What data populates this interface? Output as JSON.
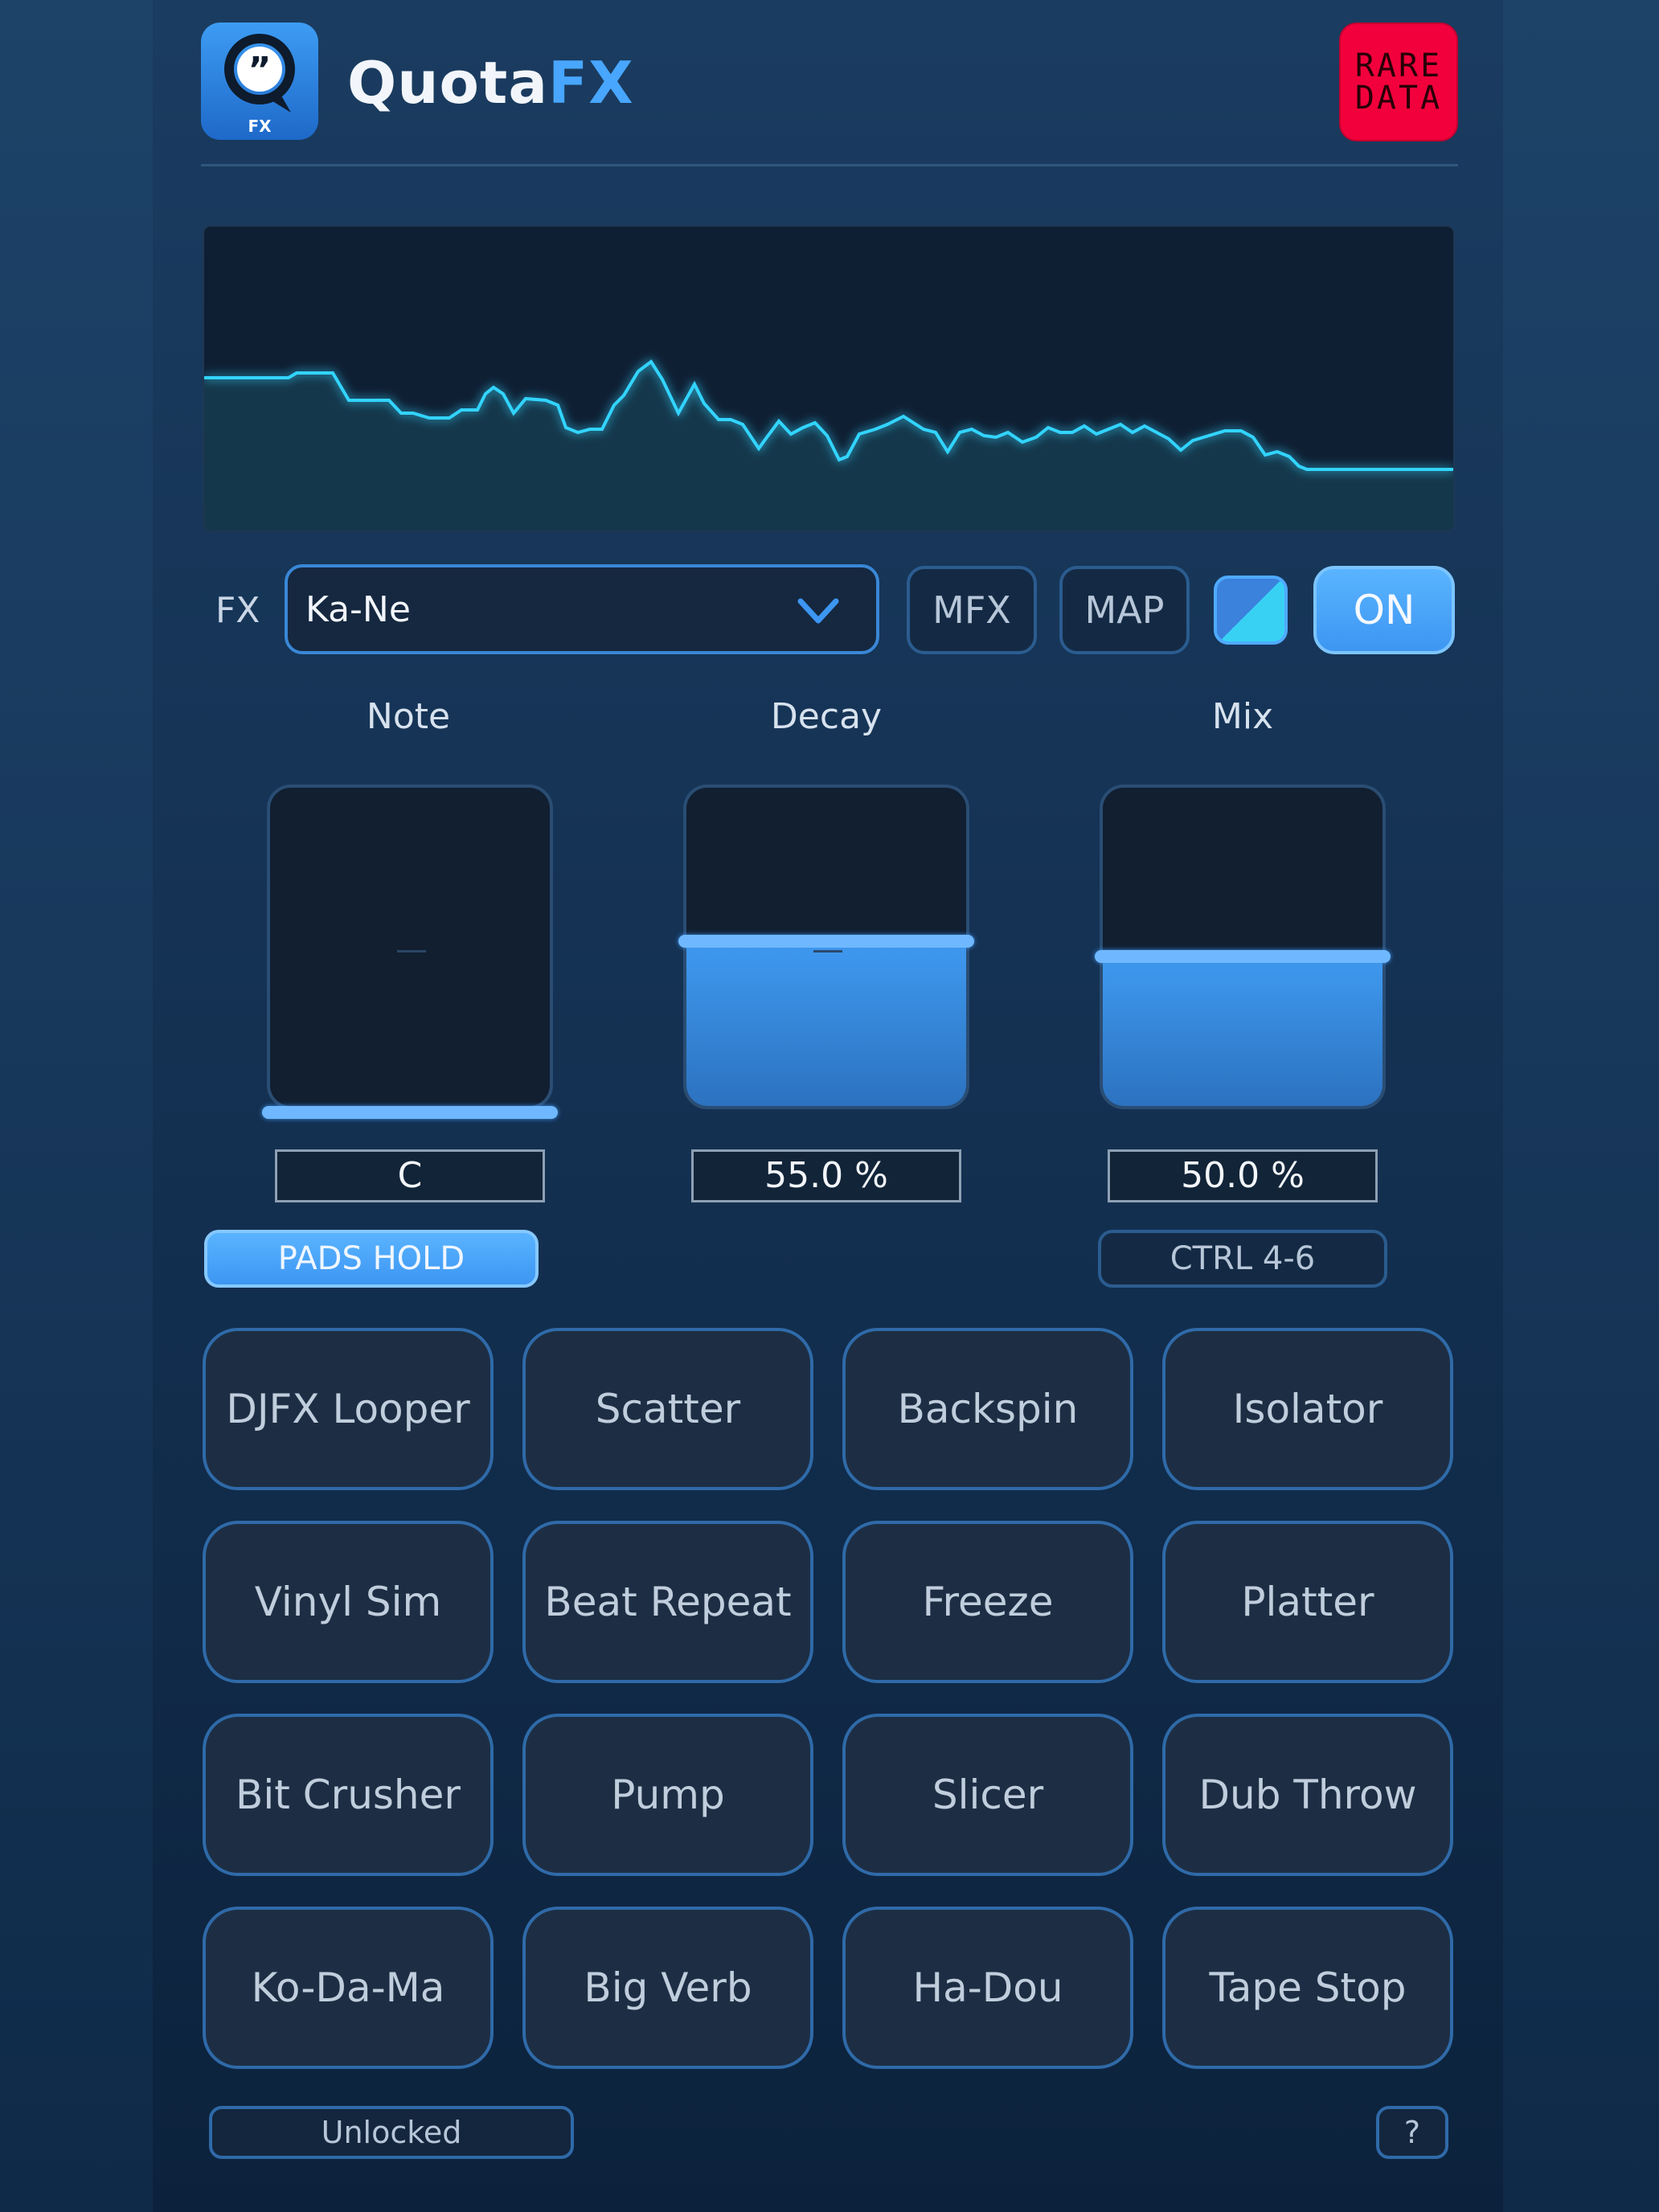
{
  "header": {
    "logo_text": "FX",
    "title_main": "Quota",
    "title_accent": "FX",
    "badge_line1": "RARE",
    "badge_line2": "DATA"
  },
  "colors": {
    "accent": "#3d96f2",
    "waveform": "#33d4ff",
    "badge": "#f2003c",
    "background": "#17375a"
  },
  "fx": {
    "label": "FX",
    "selected": "Ka-Ne",
    "mfx_label": "MFX",
    "map_label": "MAP",
    "on_label": "ON"
  },
  "params": {
    "note": {
      "label": "Note",
      "value": "C",
      "level_percent": 0
    },
    "decay": {
      "label": "Decay",
      "value": "55.0 %",
      "level_percent": 55
    },
    "mix": {
      "label": "Mix",
      "value": "50.0 %",
      "level_percent": 50
    }
  },
  "pads_hold_label": "PADS HOLD",
  "ctrl_label": "CTRL 4-6",
  "pads": [
    "DJFX Looper",
    "Scatter",
    "Backspin",
    "Isolator",
    "Vinyl Sim",
    "Beat Repeat",
    "Freeze",
    "Platter",
    "Bit Crusher",
    "Pump",
    "Slicer",
    "Dub Throw",
    "Ko-Da-Ma",
    "Big Verb",
    "Ha-Dou",
    "Tape Stop"
  ],
  "footer": {
    "status": "Unlocked",
    "help": "?"
  },
  "icons": [
    "quote-bubble-icon",
    "chevron-down-icon",
    "color-swatch-icon"
  ]
}
